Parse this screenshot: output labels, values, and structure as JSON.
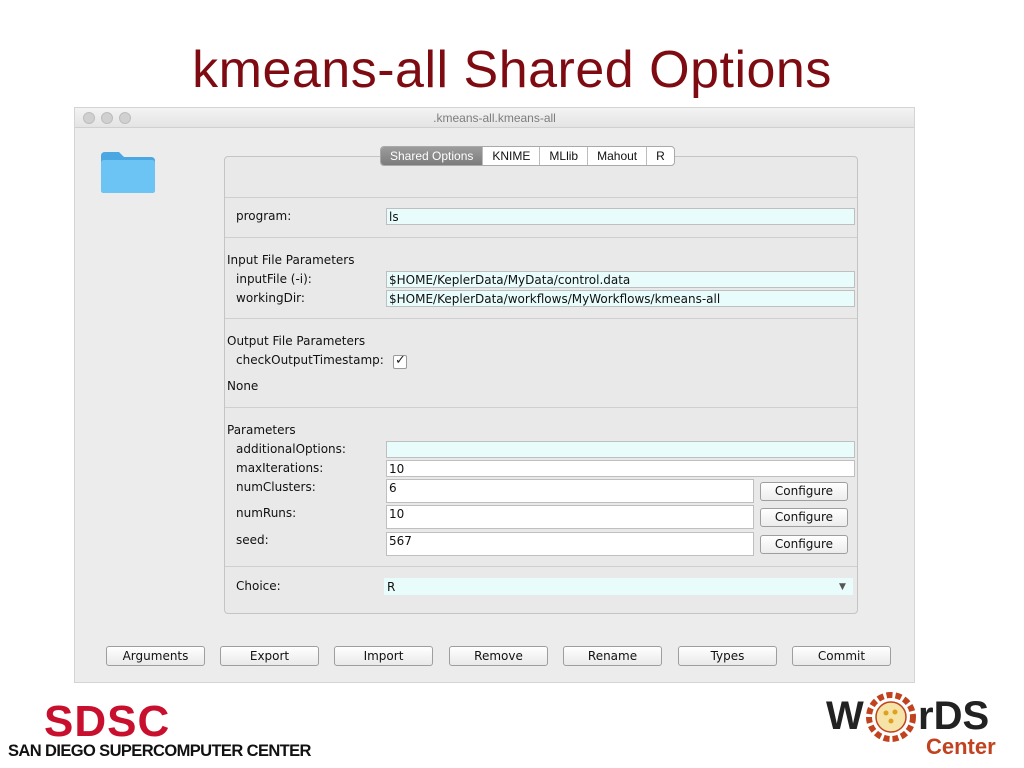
{
  "slide": {
    "title": "kmeans-all Shared Options"
  },
  "window": {
    "title": ".kmeans-all.kmeans-all"
  },
  "tabs": [
    "Shared Options",
    "KNIME",
    "MLlib",
    "Mahout",
    "R"
  ],
  "program": {
    "label": "program:",
    "value": "ls"
  },
  "input_section": {
    "heading": "Input File Parameters",
    "input_file": {
      "label": "inputFile (-i):",
      "value": "$HOME/KeplerData/MyData/control.data"
    },
    "working_dir": {
      "label": "workingDir:",
      "value": "$HOME/KeplerData/workflows/MyWorkflows/kmeans-all"
    }
  },
  "output_section": {
    "heading": "Output File Parameters",
    "check_timestamp": {
      "label": "checkOutputTimestamp:",
      "checked": true
    },
    "none_label": "None"
  },
  "parameters_section": {
    "heading": "Parameters",
    "additional_options": {
      "label": "additionalOptions:",
      "value": ""
    },
    "max_iterations": {
      "label": "maxIterations:",
      "value": "10"
    },
    "num_clusters": {
      "label": "numClusters:",
      "value": "6"
    },
    "num_runs": {
      "label": "numRuns:",
      "value": "10"
    },
    "seed": {
      "label": "seed:",
      "value": "567"
    },
    "configure_label": "Configure"
  },
  "choice": {
    "label": "Choice:",
    "value": "R"
  },
  "bottom_buttons": [
    "Arguments",
    "Export",
    "Import",
    "Remove",
    "Rename",
    "Types",
    "Commit"
  ],
  "logos": {
    "sdsc_mark": "SDSC",
    "sdsc_name": "SAN DIEGO SUPERCOMPUTER CENTER",
    "words_left": "W",
    "words_right": "rDS",
    "words_center": "Center"
  },
  "colors": {
    "title": "#7f0b12",
    "field_cyan": "#e8fcfc",
    "folder": "#5ab8f0",
    "sdsc_red": "#c8102e"
  }
}
